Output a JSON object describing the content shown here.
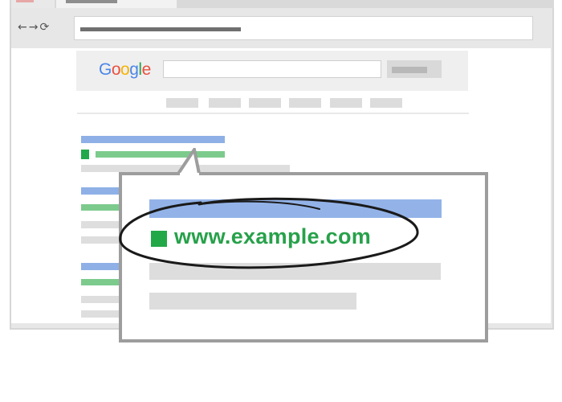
{
  "browser": {
    "nav_icons": "←→⟳",
    "address_text": ""
  },
  "search_page": {
    "logo": {
      "letters": [
        {
          "char": "G",
          "color": "#4a86e8"
        },
        {
          "char": "o",
          "color": "#e8513f"
        },
        {
          "char": "o",
          "color": "#f4b400"
        },
        {
          "char": "g",
          "color": "#4a86e8"
        },
        {
          "char": "l",
          "color": "#2ca24c"
        },
        {
          "char": "e",
          "color": "#e8513f"
        }
      ]
    },
    "search_query": "",
    "nav_tabs": [
      {
        "active": true
      },
      {
        "active": false
      },
      {
        "active": false
      },
      {
        "active": false
      },
      {
        "active": false
      },
      {
        "active": false
      }
    ]
  },
  "callout": {
    "url": "www.example.com",
    "colors": {
      "url": "#27a14a",
      "ad_badge": "#23a848",
      "headline": "#93b3e8",
      "border": "#9d9d9d",
      "highlight_ellipse": "#1a1a1a"
    }
  }
}
